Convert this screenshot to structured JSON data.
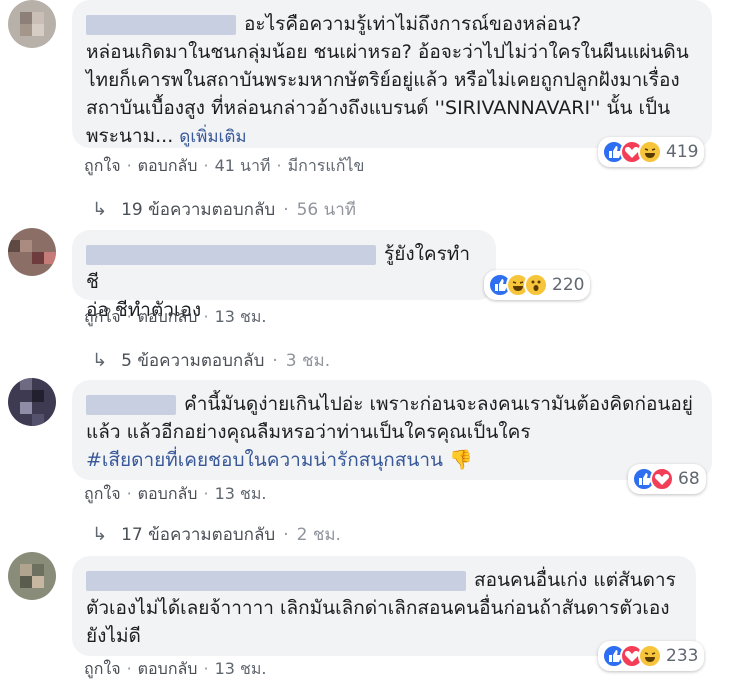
{
  "comments": [
    {
      "text": "อะไรคือความรู้เท่าไม่ถึงการณ์ของหล่อน?\nหล่อนเกิดมาในชนกลุ่มน้อย ชนเผ่าหรอ? อ้อจะว่าไปไม่ว่าใครในผืนแผ่นดินไทยก็เคารพในสถาบันพระมหากษัตริย์อยู่แล้ว หรือไม่เคยถูกปลูกฝังมาเรื่องสถาบันเบื้องสูง ที่หล่อนกล่าวอ้างถึงแบรนด์ ''SIRIVANNAVARI'' นั้น เป็นพระนาม...",
      "see_more": "ดูเพิ่มเติม",
      "reaction_count": "419",
      "like": "ถูกใจ",
      "reply": "ตอบกลับ",
      "time": "41 นาที",
      "edited": "มีการแก้ไข",
      "replies_label": "19 ข้อความตอบกลับ",
      "replies_time": "56 นาที"
    },
    {
      "text": "รู้ยังใครทำชี\nอ่อ ชีทำตัวเอง",
      "reaction_count": "220",
      "like": "ถูกใจ",
      "reply": "ตอบกลับ",
      "time": "13 ชม.",
      "replies_label": "5 ข้อความตอบกลับ",
      "replies_time": "3 ชม."
    },
    {
      "text": "คำนี้มันดูง่ายเกินไปอ่ะ เพราะก่อนจะลงคนเรามันต้องคิดก่อนอยู่แล้ว แล้วอีกอย่างคุณลืมหรอว่าท่านเป็นใครคุณเป็นใคร",
      "hashtag": "#เสียดายที่เคยชอบในความน่ารักสนุกสนาน",
      "reaction_count": "68",
      "like": "ถูกใจ",
      "reply": "ตอบกลับ",
      "time": "13 ชม.",
      "replies_label": "17 ข้อความตอบกลับ",
      "replies_time": "2 ชม."
    },
    {
      "text": "สอนคนอื่นเก่ง แต่สันดารตัวเองไม่ได้เลยจ้าาาาา เลิกมันเลิกด่าเลิกสอนคนอื่นก่อนถ้าสันดารตัวเองยังไม่ดี",
      "reaction_count": "233",
      "like": "ถูกใจ",
      "reply": "ตอบกลับ",
      "time": "13 ชม."
    }
  ],
  "separator": "·",
  "colors": {
    "like_blue": "#2e6ef0",
    "love_red": "#f33e58",
    "haha_yellow": "#f7c53c",
    "link_blue": "#385898",
    "bubble_bg": "#f2f3f5"
  }
}
